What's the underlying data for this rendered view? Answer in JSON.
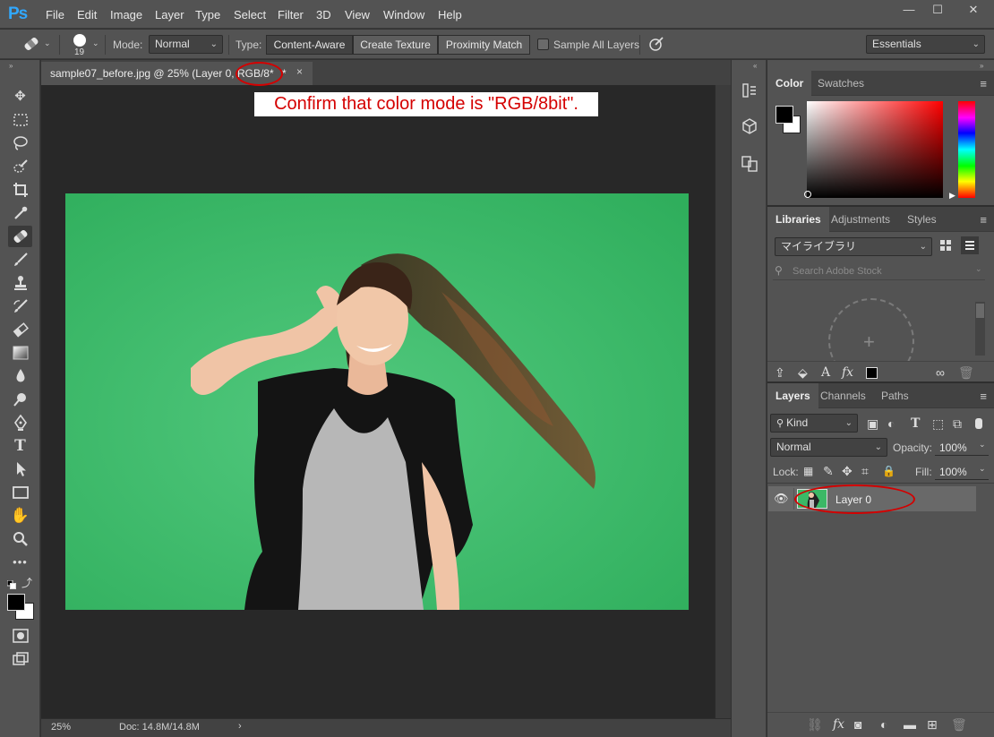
{
  "app": {
    "logo": "Ps"
  },
  "menu": [
    "File",
    "Edit",
    "Image",
    "Layer",
    "Type",
    "Select",
    "Filter",
    "3D",
    "View",
    "Window",
    "Help"
  ],
  "window_buttons": {
    "minimize": "—",
    "restore": "☐",
    "close": "✕"
  },
  "options_bar": {
    "brush_size": "19",
    "mode_label": "Mode:",
    "mode_value": "Normal",
    "type_label": "Type:",
    "type_options": [
      "Content-Aware",
      "Create Texture",
      "Proximity Match"
    ],
    "type_selected": "Content-Aware",
    "sample_all_layers": "Sample All Layers",
    "workspace": "Essentials"
  },
  "document": {
    "tab_title": "sample07_before.jpg @ 25% (Layer 0, RGB/8*",
    "tab_modified": "*",
    "close": "×",
    "annotation": "Confirm that color mode is \"RGB/8bit\"."
  },
  "status_bar": {
    "zoom": "25%",
    "doc_info": "Doc: 14.8M/14.8M",
    "arrow": "›"
  },
  "color_panel": {
    "tabs": [
      "Color",
      "Swatches"
    ],
    "foreground": "#000000",
    "background": "#ffffff"
  },
  "libraries_panel": {
    "tabs": [
      "Libraries",
      "Adjustments",
      "Styles"
    ],
    "library_name": "マイライブラリ",
    "search_placeholder": "Search Adobe Stock"
  },
  "layers_panel": {
    "tabs": [
      "Layers",
      "Channels",
      "Paths"
    ],
    "filter_kind": "Kind",
    "blend_mode": "Normal",
    "opacity_label": "Opacity:",
    "opacity_value": "100%",
    "lock_label": "Lock:",
    "fill_label": "Fill:",
    "fill_value": "100%",
    "layers": [
      {
        "name": "Layer 0",
        "visible": true
      }
    ]
  },
  "colors": {
    "accent": "#31a8ff",
    "annotation_red": "#d40000",
    "photo_green": "#3bb866"
  }
}
